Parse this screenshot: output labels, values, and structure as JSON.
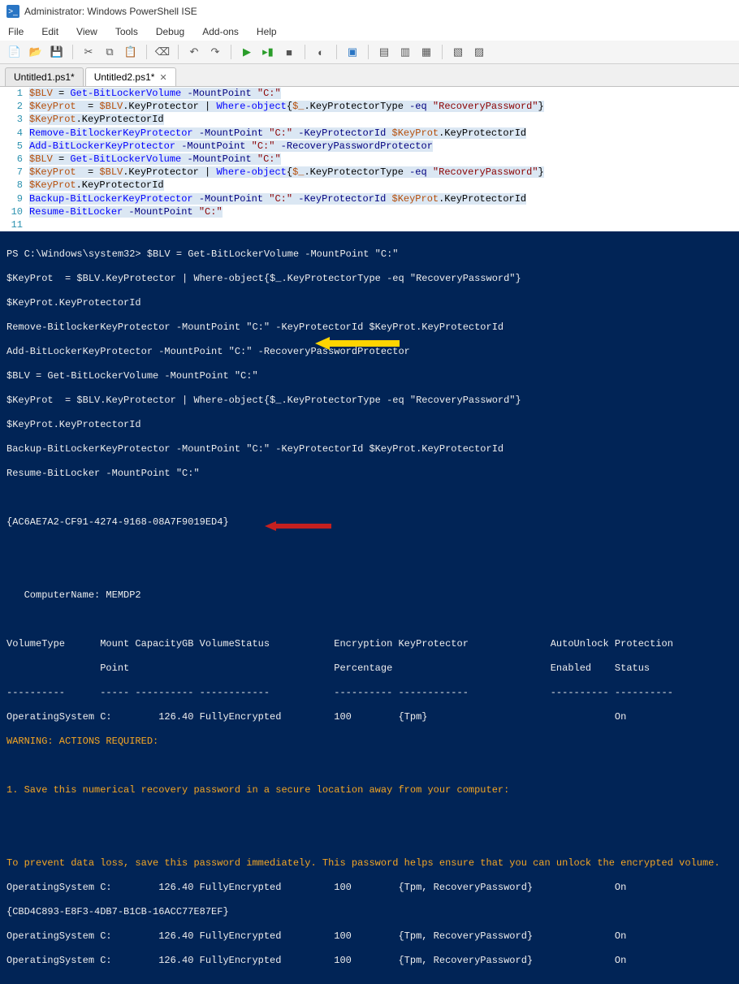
{
  "window": {
    "title": "Administrator: Windows PowerShell ISE"
  },
  "menu": {
    "file": "File",
    "edit": "Edit",
    "view": "View",
    "tools": "Tools",
    "debug": "Debug",
    "addons": "Add-ons",
    "help": "Help"
  },
  "tabs": {
    "t1": "Untitled1.ps1*",
    "t2": "Untitled2.ps1*"
  },
  "editor": {
    "l1a": "$BLV",
    "l1b": " = ",
    "l1c": "Get-BitLockerVolume",
    "l1d": " -MountPoint ",
    "l1e": "\"C:\"",
    "l2a": "$KeyProt",
    "l2b": "  = ",
    "l2c": "$BLV",
    "l2d": ".KeyProtector | ",
    "l2e": "Where-object",
    "l2f": "{",
    "l2g": "$_",
    "l2h": ".KeyProtectorType ",
    "l2i": "-eq",
    "l2j": " ",
    "l2k": "\"RecoveryPassword\"",
    "l2l": "}",
    "l3a": "$KeyProt",
    "l3b": ".KeyProtectorId",
    "l4a": "Remove-BitlockerKeyProtector",
    "l4b": " -MountPoint ",
    "l4c": "\"C:\"",
    "l4d": " -KeyProtectorId ",
    "l4e": "$KeyProt",
    "l4f": ".KeyProtectorId",
    "l5a": "Add-BitLockerKeyProtector",
    "l5b": " -MountPoint ",
    "l5c": "\"C:\"",
    "l5d": " -RecoveryPasswordProtector",
    "l6a": "$BLV",
    "l6b": " = ",
    "l6c": "Get-BitLockerVolume",
    "l6d": " -MountPoint ",
    "l6e": "\"C:\"",
    "l7a": "$KeyProt",
    "l7b": "  = ",
    "l7c": "$BLV",
    "l7d": ".KeyProtector | ",
    "l7e": "Where-object",
    "l7f": "{",
    "l7g": "$_",
    "l7h": ".KeyProtectorType ",
    "l7i": "-eq",
    "l7j": " ",
    "l7k": "\"RecoveryPassword\"",
    "l7l": "}",
    "l8a": "$KeyProt",
    "l8b": ".KeyProtectorId",
    "l9a": "Backup-BitLockerKeyProtector",
    "l9b": " -MountPoint ",
    "l9c": "\"C:\"",
    "l9d": " -KeyProtectorId ",
    "l9e": "$KeyProt",
    "l9f": ".KeyProtectorId",
    "l10a": "Resume-BitLocker",
    "l10b": " -MountPoint ",
    "l10c": "\"C:\"",
    "g1": "1",
    "g2": "2",
    "g3": "3",
    "g4": "4",
    "g5": "5",
    "g6": "6",
    "g7": "7",
    "g8": "8",
    "g9": "9",
    "g10": "10",
    "g11": "11"
  },
  "console": {
    "c1": "PS C:\\Windows\\system32> $BLV = Get-BitLockerVolume -MountPoint \"C:\"",
    "c2": "$KeyProt  = $BLV.KeyProtector | Where-object{$_.KeyProtectorType -eq \"RecoveryPassword\"}",
    "c3": "$KeyProt.KeyProtectorId",
    "c4": "Remove-BitlockerKeyProtector -MountPoint \"C:\" -KeyProtectorId $KeyProt.KeyProtectorId",
    "c5": "Add-BitLockerKeyProtector -MountPoint \"C:\" -RecoveryPasswordProtector",
    "c6": "$BLV = Get-BitLockerVolume -MountPoint \"C:\"",
    "c7": "$KeyProt  = $BLV.KeyProtector | Where-object{$_.KeyProtectorType -eq \"RecoveryPassword\"}",
    "c8": "$KeyProt.KeyProtectorId",
    "c9": "Backup-BitLockerKeyProtector -MountPoint \"C:\" -KeyProtectorId $KeyProt.KeyProtectorId",
    "c10": "Resume-BitLocker -MountPoint \"C:\"",
    "c11": " ",
    "c12": "{AC6AE7A2-CF91-4274-9168-08A7F9019ED4}",
    "c13": " ",
    "c14": " ",
    "c15": "   ComputerName: MEMDP2",
    "c16": " ",
    "c17": "VolumeType      Mount CapacityGB VolumeStatus           Encryption KeyProtector              AutoUnlock Protection",
    "c18": "                Point                                   Percentage                           Enabled    Status    ",
    "c19": "----------      ----- ---------- ------------           ---------- ------------              ---------- ----------",
    "c20": "OperatingSystem C:        126.40 FullyEncrypted         100        {Tpm}                                On        ",
    "w1": "WARNING: ACTIONS REQUIRED:",
    "w2": " ",
    "w3": "1. Save this numerical recovery password in a secure location away from your computer:",
    "w4": " ",
    "w5": " ",
    "w6": "To prevent data loss, save this password immediately. This password helps ensure that you can unlock the encrypted volume.",
    "c21": "OperatingSystem C:        126.40 FullyEncrypted         100        {Tpm, RecoveryPassword}              On        ",
    "c22": "{CBD4C893-E8F3-4DB7-B1CB-16ACC77E87EF}",
    "c23": "OperatingSystem C:        126.40 FullyEncrypted         100        {Tpm, RecoveryPassword}              On        ",
    "c24": "OperatingSystem C:        126.40 FullyEncrypted         100        {Tpm, RecoveryPassword}              On        "
  }
}
